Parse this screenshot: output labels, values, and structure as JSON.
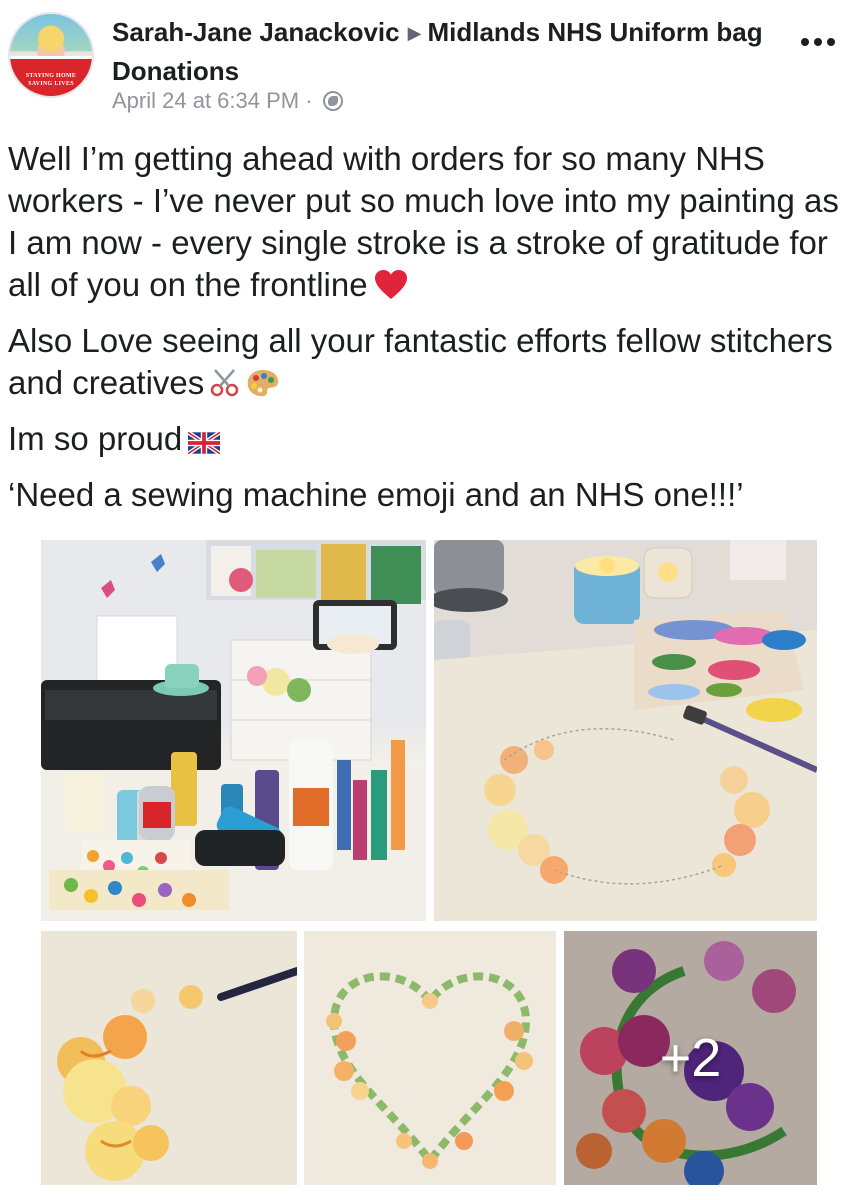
{
  "header": {
    "author": "Sarah-Jane Janackovic",
    "group": "Midlands NHS Uniform bag Donations",
    "timestamp": "April 24 at 6:34 PM ·",
    "privacy_icon": "globe-icon",
    "avatar_frame_text_1": "STAYING HOME",
    "avatar_frame_text_2": "SAVING LIVES",
    "more_icon": "more-options-icon"
  },
  "post": {
    "paragraph_1": "Well I’m getting ahead with orders for so many NHS workers - I’ve never put so much love into my painting as I am now - every single stroke is a stroke of gratitude for all of you on the frontline",
    "paragraph_2": "Also Love seeing all your fantastic efforts fellow stitchers and creatives",
    "paragraph_3": "Im so proud",
    "paragraph_4": "‘Need a sewing machine emoji and an NHS one!!!’",
    "emoji_1": "red-heart-emoji",
    "emoji_2": "scissors-emoji",
    "emoji_3": "artist-palette-emoji",
    "emoji_4": "uk-flag-emoji"
  },
  "photos": {
    "count_shown": 5,
    "more_label": "+2"
  },
  "colors": {
    "text": "#1c1e21",
    "meta": "#90949c",
    "avatar_frame": "#d9262b",
    "heart": "#e0243a"
  }
}
